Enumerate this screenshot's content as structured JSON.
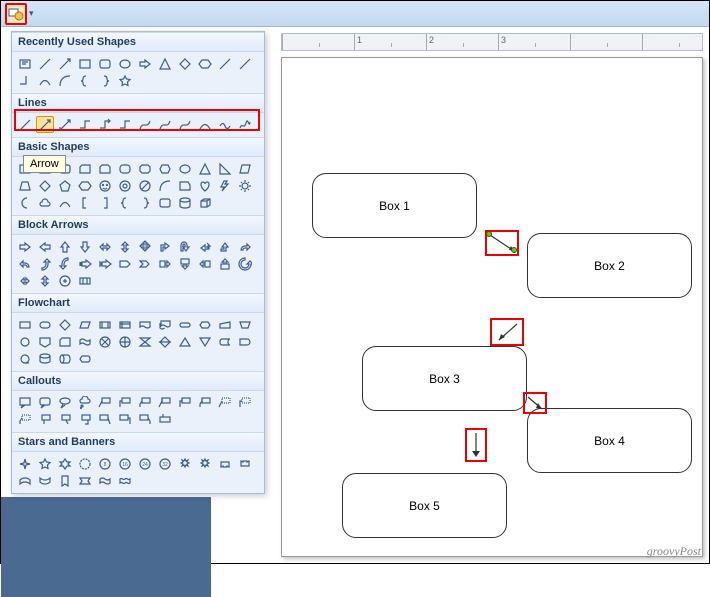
{
  "qat": {
    "shapes_btn": "shapes-gallery",
    "dropdown": "▾"
  },
  "tooltip": "Arrow",
  "shapes_panel": {
    "sections": {
      "recent": "Recently Used Shapes",
      "lines": "Lines",
      "basic": "Basic Shapes",
      "block_arrows": "Block Arrows",
      "flowchart": "Flowchart",
      "callouts": "Callouts",
      "stars": "Stars and Banners"
    }
  },
  "ruler": {
    "marks": [
      "",
      "1",
      "2",
      "3"
    ]
  },
  "canvas": {
    "boxes": [
      {
        "id": "box1",
        "label": "Box 1"
      },
      {
        "id": "box2",
        "label": "Box 2"
      },
      {
        "id": "box3",
        "label": "Box 3"
      },
      {
        "id": "box4",
        "label": "Box 4"
      },
      {
        "id": "box5",
        "label": "Box 5"
      }
    ]
  },
  "watermark": "groovyPost"
}
